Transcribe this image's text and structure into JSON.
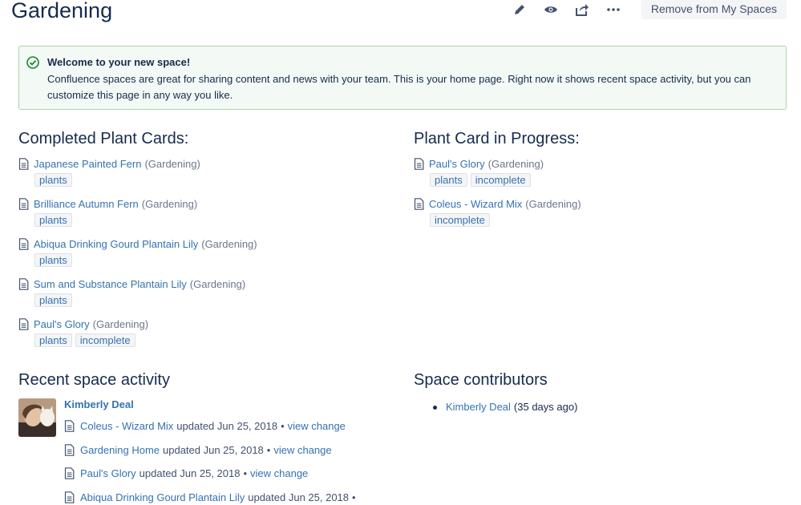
{
  "header": {
    "title": "Gardening",
    "remove_button": "Remove from My Spaces",
    "icons": [
      "pencil-icon",
      "eye-icon",
      "share-icon",
      "more-icon"
    ]
  },
  "welcome": {
    "title": "Welcome to your new space!",
    "body": "Confluence spaces are great for sharing content and news with your team. This is your home page. Right now it shows recent space activity, but you can customize this page in any way you like."
  },
  "completed": {
    "heading": "Completed Plant Cards:",
    "items": [
      {
        "title": "Japanese Painted Fern",
        "space": "(Gardening)",
        "labels": [
          "plants"
        ]
      },
      {
        "title": "Brilliance Autumn Fern",
        "space": "(Gardening)",
        "labels": [
          "plants"
        ]
      },
      {
        "title": "Abiqua Drinking Gourd Plantain Lily",
        "space": "(Gardening)",
        "labels": [
          "plants"
        ]
      },
      {
        "title": "Sum and Substance Plantain Lily",
        "space": "(Gardening)",
        "labels": [
          "plants"
        ]
      },
      {
        "title": "Paul's Glory",
        "space": "(Gardening)",
        "labels": [
          "plants",
          "incomplete"
        ]
      }
    ]
  },
  "in_progress": {
    "heading": "Plant Card in Progress:",
    "items": [
      {
        "title": "Paul's Glory",
        "space": "(Gardening)",
        "labels": [
          "plants",
          "incomplete"
        ]
      },
      {
        "title": "Coleus - Wizard Mix",
        "space": "(Gardening)",
        "labels": [
          "incomplete"
        ]
      }
    ]
  },
  "activity": {
    "heading": "Recent space activity",
    "user": "Kimberly Deal",
    "items": [
      {
        "title": "Coleus - Wizard Mix",
        "text": "updated Jun 25, 2018",
        "sep": "•",
        "link": "view change"
      },
      {
        "title": "Gardening Home",
        "text": "updated Jun 25, 2018",
        "sep": "•",
        "link": "view change"
      },
      {
        "title": "Paul's Glory",
        "text": "updated Jun 25, 2018",
        "sep": "•",
        "link": "view change"
      },
      {
        "title": "Abiqua Drinking Gourd Plantain Lily",
        "text": "updated Jun 25, 2018",
        "sep": "•",
        "link": ""
      }
    ]
  },
  "contributors": {
    "heading": "Space contributors",
    "items": [
      {
        "name": "Kimberly Deal",
        "when": "(35 days ago)"
      }
    ]
  },
  "colors": {
    "link": "#3572b0",
    "text": "#172b4d",
    "success_bg": "#f3f9f4",
    "success_border": "#abd5ab",
    "success_icon": "#14892c"
  }
}
